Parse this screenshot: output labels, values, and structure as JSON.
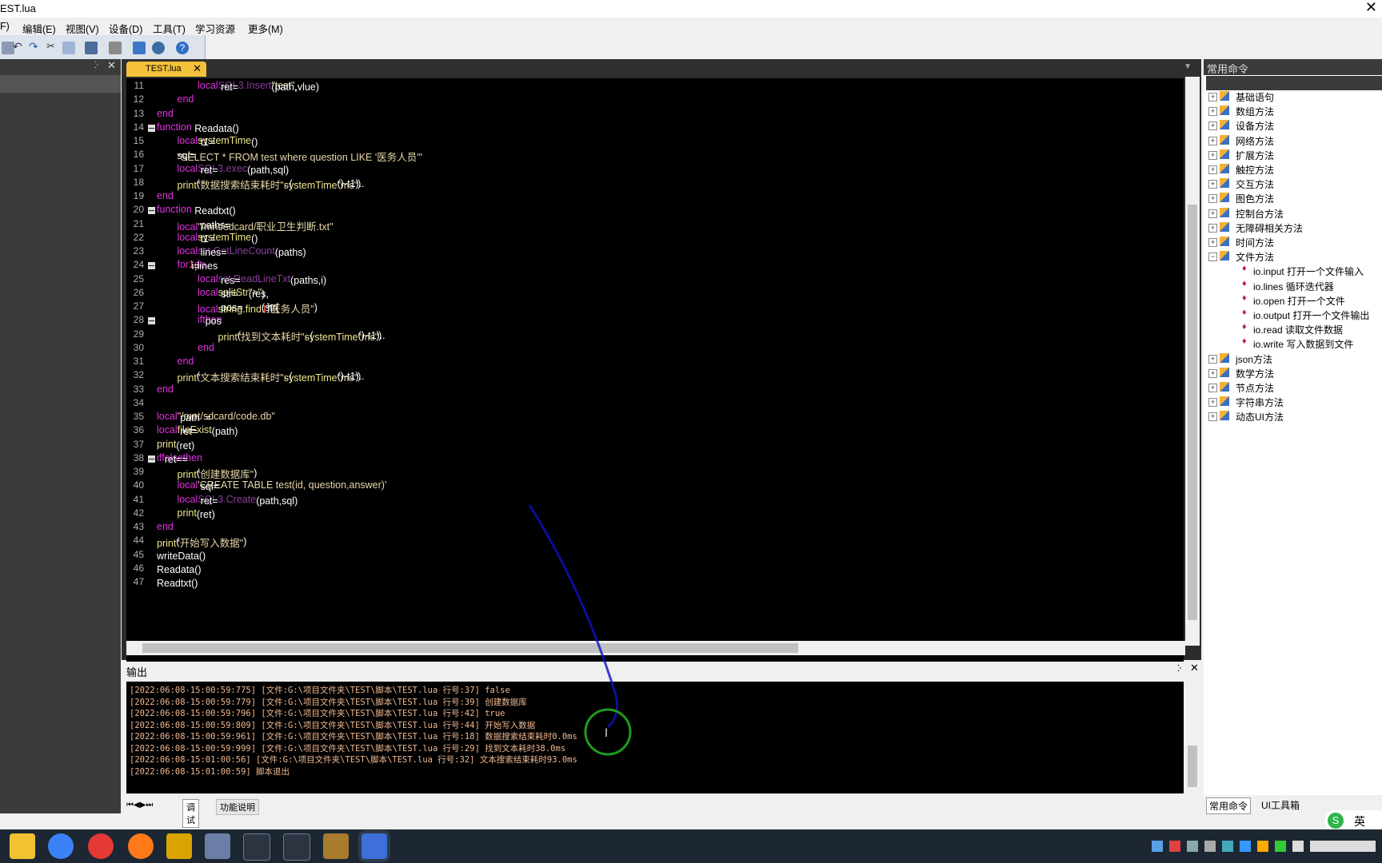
{
  "window": {
    "title": "EST.lua",
    "close_glyph": "✕"
  },
  "menu": {
    "items": [
      "F)",
      "编辑(E)",
      "视图(V)",
      "设备(D)",
      "工具(T)",
      "学习资源",
      "更多(M)"
    ]
  },
  "editor": {
    "tab_label": "TEST.lua",
    "lines": [
      {
        "n": "11",
        "indent": 2,
        "tokens": [
          [
            "kw",
            "local"
          ],
          [
            "tx",
            " ret="
          ],
          [
            "sf",
            "SQL3.Insert"
          ],
          [
            "tx",
            "(path,"
          ],
          [
            "st",
            "\"test\""
          ],
          [
            "tx",
            ",vlue)"
          ]
        ]
      },
      {
        "n": "12",
        "indent": 1,
        "tokens": [
          [
            "kw",
            "end"
          ]
        ]
      },
      {
        "n": "13",
        "indent": 0,
        "tokens": [
          [
            "kw",
            "end"
          ]
        ]
      },
      {
        "n": "14",
        "indent": 0,
        "fold": true,
        "tokens": [
          [
            "kw",
            "function"
          ],
          [
            "tx",
            " Readata()"
          ]
        ]
      },
      {
        "n": "15",
        "indent": 1,
        "tokens": [
          [
            "kw",
            "local"
          ],
          [
            "tx",
            " t1="
          ],
          [
            "fn",
            "systemTime"
          ],
          [
            "tx",
            "()"
          ]
        ]
      },
      {
        "n": "16",
        "indent": 1,
        "tokens": [
          [
            "tx",
            "sql="
          ],
          [
            "st",
            "\"SELECT * FROM test where question LIKE '医务人员'\""
          ]
        ]
      },
      {
        "n": "17",
        "indent": 1,
        "tokens": [
          [
            "kw",
            "local"
          ],
          [
            "tx",
            " ret="
          ],
          [
            "sf",
            "SQL3.exec"
          ],
          [
            "tx",
            "(path,sql)"
          ]
        ]
      },
      {
        "n": "18",
        "indent": 1,
        "tokens": [
          [
            "fn",
            "print"
          ],
          [
            "tx",
            "("
          ],
          [
            "st",
            "\"数据搜索结束耗时\""
          ],
          [
            "tx",
            "..("
          ],
          [
            "fn",
            "systemTime"
          ],
          [
            "tx",
            "()-t1).."
          ],
          [
            "st",
            "\"ms\""
          ],
          [
            "tx",
            ")"
          ]
        ]
      },
      {
        "n": "19",
        "indent": 0,
        "tokens": [
          [
            "kw",
            "end"
          ]
        ]
      },
      {
        "n": "20",
        "indent": 0,
        "fold": true,
        "tokens": [
          [
            "kw",
            "function"
          ],
          [
            "tx",
            " Readtxt()"
          ]
        ]
      },
      {
        "n": "21",
        "indent": 1,
        "tokens": [
          [
            "kw",
            "local"
          ],
          [
            "tx",
            " paths="
          ],
          [
            "st",
            "\"/mnt/sdcard/职业卫生判断.txt\""
          ]
        ]
      },
      {
        "n": "22",
        "indent": 1,
        "tokens": [
          [
            "kw",
            "local"
          ],
          [
            "tx",
            " t1="
          ],
          [
            "fn",
            "systemTime"
          ],
          [
            "tx",
            "()"
          ]
        ]
      },
      {
        "n": "23",
        "indent": 1,
        "tokens": [
          [
            "kw",
            "local"
          ],
          [
            "tx",
            " lines="
          ],
          [
            "sf",
            "sct.GetLineCount"
          ],
          [
            "tx",
            "(paths)"
          ]
        ]
      },
      {
        "n": "24",
        "indent": 1,
        "fold": true,
        "tokens": [
          [
            "kw",
            "for"
          ],
          [
            "tx",
            " i="
          ],
          [
            "nm",
            "1"
          ],
          [
            "tx",
            ",lines "
          ],
          [
            "kw",
            "do"
          ]
        ]
      },
      {
        "n": "25",
        "indent": 2,
        "tokens": [
          [
            "kw",
            "local"
          ],
          [
            "tx",
            " res="
          ],
          [
            "sf",
            "sct.ReadLineTxt"
          ],
          [
            "tx",
            "(paths,i)"
          ]
        ]
      },
      {
        "n": "26",
        "indent": 2,
        "tokens": [
          [
            "kw",
            "local"
          ],
          [
            "tx",
            " str="
          ],
          [
            "fn",
            "splitStr"
          ],
          [
            "tx",
            "(res,"
          ],
          [
            "st",
            "\">\""
          ],
          [
            "tx",
            ")"
          ]
        ]
      },
      {
        "n": "27",
        "indent": 2,
        "tokens": [
          [
            "kw",
            "local"
          ],
          [
            "tx",
            " pos="
          ],
          [
            "fn",
            "string.find"
          ],
          [
            "tx",
            "(str["
          ],
          [
            "nm",
            "1"
          ],
          [
            "tx",
            "],"
          ],
          [
            "st",
            "\"医务人员\""
          ],
          [
            "tx",
            ")"
          ]
        ]
      },
      {
        "n": "28",
        "indent": 2,
        "fold": true,
        "tokens": [
          [
            "kw",
            "if"
          ],
          [
            "tx",
            " pos "
          ],
          [
            "kw",
            "then"
          ]
        ]
      },
      {
        "n": "29",
        "indent": 3,
        "tokens": [
          [
            "fn",
            "print"
          ],
          [
            "tx",
            "("
          ],
          [
            "st",
            "\"找到文本耗时\""
          ],
          [
            "tx",
            "..("
          ],
          [
            "fn",
            "systemTime"
          ],
          [
            "tx",
            "()-t1).."
          ],
          [
            "st",
            "\"ms\""
          ],
          [
            "tx",
            ")"
          ]
        ]
      },
      {
        "n": "30",
        "indent": 2,
        "tokens": [
          [
            "kw",
            "end"
          ]
        ]
      },
      {
        "n": "31",
        "indent": 1,
        "tokens": [
          [
            "kw",
            "end"
          ]
        ]
      },
      {
        "n": "32",
        "indent": 1,
        "tokens": [
          [
            "fn",
            "print"
          ],
          [
            "tx",
            "("
          ],
          [
            "st",
            "\"文本搜索结束耗时\""
          ],
          [
            "tx",
            "..("
          ],
          [
            "fn",
            "systemTime"
          ],
          [
            "tx",
            "()-t1).."
          ],
          [
            "st",
            "\"ms\""
          ],
          [
            "tx",
            ")"
          ]
        ]
      },
      {
        "n": "33",
        "indent": 0,
        "tokens": [
          [
            "kw",
            "end"
          ]
        ]
      },
      {
        "n": "34",
        "indent": 0,
        "tokens": []
      },
      {
        "n": "35",
        "indent": 0,
        "tokens": [
          [
            "kw",
            "local"
          ],
          [
            "tx",
            " path  ="
          ],
          [
            "st",
            "\"/mnt/sdcard/code.db\""
          ]
        ]
      },
      {
        "n": "36",
        "indent": 0,
        "tokens": [
          [
            "kw",
            "local"
          ],
          [
            "tx",
            " ret="
          ],
          [
            "fn",
            "fileExist"
          ],
          [
            "tx",
            "(path)"
          ]
        ]
      },
      {
        "n": "37",
        "indent": 0,
        "tokens": [
          [
            "fn",
            "print"
          ],
          [
            "tx",
            "(ret)"
          ]
        ]
      },
      {
        "n": "38",
        "indent": 0,
        "fold": true,
        "tokens": [
          [
            "kw",
            "if"
          ],
          [
            "tx",
            " ret=="
          ],
          [
            "kw",
            "false"
          ],
          [
            "tx",
            " "
          ],
          [
            "kw",
            "then"
          ]
        ]
      },
      {
        "n": "39",
        "indent": 1,
        "tokens": [
          [
            "fn",
            "print"
          ],
          [
            "tx",
            "("
          ],
          [
            "st",
            "\"创建数据库\""
          ],
          [
            "tx",
            ")"
          ]
        ]
      },
      {
        "n": "40",
        "indent": 1,
        "tokens": [
          [
            "kw",
            "local"
          ],
          [
            "tx",
            " sql="
          ],
          [
            "st",
            "'CREATE TABLE test(id, question,answer)'"
          ]
        ]
      },
      {
        "n": "41",
        "indent": 1,
        "tokens": [
          [
            "kw",
            "local"
          ],
          [
            "tx",
            " ret="
          ],
          [
            "sf",
            "SQL3.Create"
          ],
          [
            "tx",
            "(path,sql)"
          ]
        ]
      },
      {
        "n": "42",
        "indent": 1,
        "tokens": [
          [
            "fn",
            "print"
          ],
          [
            "tx",
            "(ret)"
          ]
        ]
      },
      {
        "n": "43",
        "indent": 0,
        "tokens": [
          [
            "kw",
            "end"
          ]
        ]
      },
      {
        "n": "44",
        "indent": 0,
        "tokens": [
          [
            "fn",
            "print"
          ],
          [
            "tx",
            "("
          ],
          [
            "st",
            "\"开始写入数据\""
          ],
          [
            "tx",
            ")"
          ]
        ]
      },
      {
        "n": "45",
        "indent": 0,
        "tokens": [
          [
            "tx",
            "writeData()"
          ]
        ]
      },
      {
        "n": "46",
        "indent": 0,
        "tokens": [
          [
            "tx",
            "Readata()"
          ]
        ]
      },
      {
        "n": "47",
        "indent": 0,
        "tokens": [
          [
            "tx",
            "Readtxt()"
          ]
        ]
      }
    ]
  },
  "output": {
    "title": "输出",
    "lines": [
      "[2022:06:08-15:00:59:775] [文件:G:\\项目文件夹\\TEST\\脚本\\TEST.lua 行号:37] false",
      "[2022:06:08-15:00:59:779] [文件:G:\\项目文件夹\\TEST\\脚本\\TEST.lua 行号:39] 创建数据库",
      "[2022:06:08-15:00:59:796] [文件:G:\\项目文件夹\\TEST\\脚本\\TEST.lua 行号:42] true",
      "[2022:06:08-15:00:59:809] [文件:G:\\项目文件夹\\TEST\\脚本\\TEST.lua 行号:44] 开始写入数据",
      "[2022:06:08-15:00:59:961] [文件:G:\\项目文件夹\\TEST\\脚本\\TEST.lua 行号:18] 数据搜索结束耗时0.0ms",
      "[2022:06:08-15:00:59:999] [文件:G:\\项目文件夹\\TEST\\脚本\\TEST.lua 行号:29] 找到文本耗时38.0ms",
      "[2022:06:08-15:01:00:56] [文件:G:\\项目文件夹\\TEST\\脚本\\TEST.lua 行号:32] 文本搜索结束耗时93.0ms",
      "[2022:06:08-15:01:00:59] 脚本退出"
    ],
    "tabs": [
      "调试",
      "功能说明"
    ]
  },
  "commands": {
    "header": "常用命令",
    "tree": [
      {
        "label": "基础语句",
        "expanded": false
      },
      {
        "label": "数组方法",
        "expanded": false
      },
      {
        "label": "设备方法",
        "expanded": false
      },
      {
        "label": "网络方法",
        "expanded": false
      },
      {
        "label": "扩展方法",
        "expanded": false
      },
      {
        "label": "触控方法",
        "expanded": false
      },
      {
        "label": "交互方法",
        "expanded": false
      },
      {
        "label": "图色方法",
        "expanded": false
      },
      {
        "label": "控制台方法",
        "expanded": false
      },
      {
        "label": "无障碍相关方法",
        "expanded": false
      },
      {
        "label": "时间方法",
        "expanded": false
      },
      {
        "label": "文件方法",
        "expanded": true,
        "children": [
          "io.input 打开一个文件输入",
          "io.lines 循环迭代器",
          "io.open 打开一个文件",
          "io.output 打开一个文件输出",
          "io.read 读取文件数据",
          "io.write 写入数据到文件"
        ]
      },
      {
        "label": "json方法",
        "expanded": false
      },
      {
        "label": "数学方法",
        "expanded": false
      },
      {
        "label": "节点方法",
        "expanded": false
      },
      {
        "label": "字符串方法",
        "expanded": false
      },
      {
        "label": "动态UI方法",
        "expanded": false
      }
    ],
    "bottom_tabs": [
      "常用命令",
      "UI工具箱"
    ]
  },
  "ime": {
    "label": "英"
  },
  "colors": {
    "keyword": "#e033e0",
    "function": "#f0e68c",
    "string": "#e8d6a8",
    "sql_func": "#8a3f9c",
    "log_text": "#f0b890",
    "tab_active": "#f5c03a"
  }
}
